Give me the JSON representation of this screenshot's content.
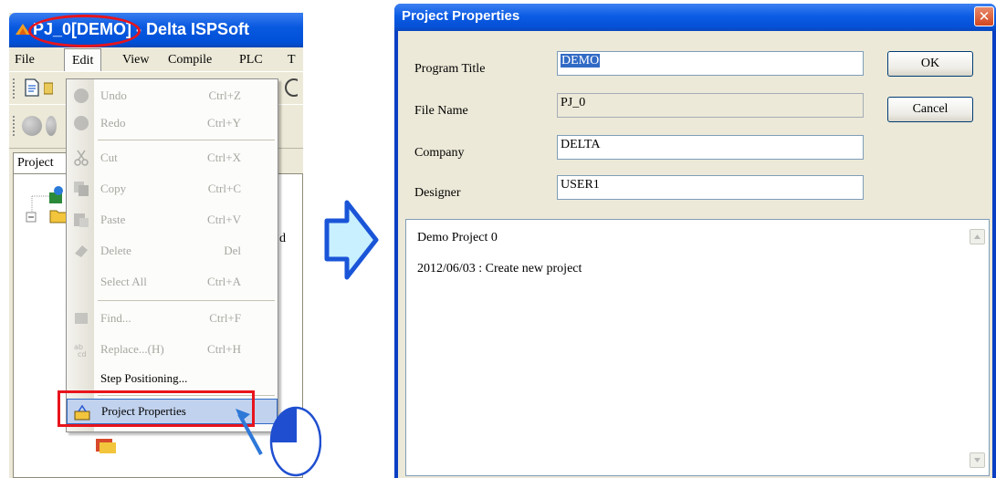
{
  "app_window": {
    "title_name": "PJ_0[DEMO]",
    "title_rest": " - Delta ISPSoft",
    "menu": [
      "File",
      "Edit",
      "View",
      "Compile",
      "PLC",
      "T"
    ],
    "project_tab": "Project",
    "peek_text": "d"
  },
  "edit_menu": {
    "items": [
      {
        "label": "Undo",
        "shortcut": "Ctrl+Z"
      },
      {
        "label": "Redo",
        "shortcut": "Ctrl+Y"
      },
      {
        "label": "Cut",
        "shortcut": "Ctrl+X"
      },
      {
        "label": "Copy",
        "shortcut": "Ctrl+C"
      },
      {
        "label": "Paste",
        "shortcut": "Ctrl+V"
      },
      {
        "label": "Delete",
        "shortcut": "Del"
      },
      {
        "label": "Select All",
        "shortcut": "Ctrl+A"
      },
      {
        "label": "Find...",
        "shortcut": "Ctrl+F"
      },
      {
        "label": "Replace...(H)",
        "shortcut": "Ctrl+H"
      },
      {
        "label": "Step Positioning...",
        "shortcut": ""
      },
      {
        "label": "Project Properties",
        "shortcut": ""
      }
    ]
  },
  "dialog": {
    "title": "Project Properties",
    "close_glyph": "✕",
    "fields": [
      {
        "label": "Program Title",
        "value": "DEMO"
      },
      {
        "label": "File Name",
        "value": "PJ_0"
      },
      {
        "label": "Company",
        "value": "DELTA"
      },
      {
        "label": "Designer",
        "value": "USER1"
      }
    ],
    "ok_label": "OK",
    "cancel_label": "Cancel",
    "memo_lines": [
      "Demo Project 0",
      "2012/06/03 : Create new project"
    ]
  },
  "colors": {
    "titlebar_blue": "#0a5ae0",
    "highlight_red": "#e8141c",
    "arrow_fill": "#c8f0ff",
    "arrow_stroke": "#1a55d8"
  }
}
